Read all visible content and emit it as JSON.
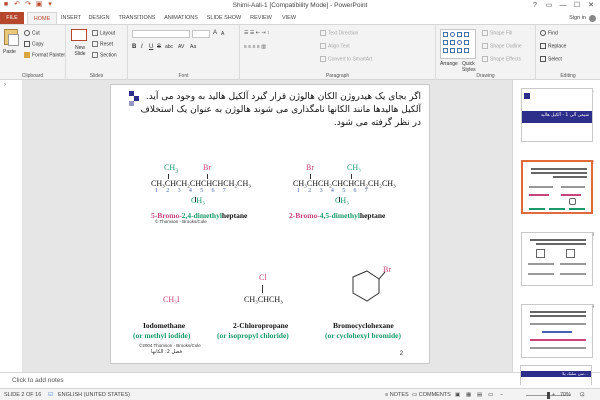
{
  "window": {
    "title": "Shimi-Aali-1 [Compatibility Mode] - PowerPoint",
    "controls": [
      "?",
      "▭",
      "—",
      "☐",
      "✕"
    ]
  },
  "qat": [
    "save-icon",
    "undo-icon",
    "redo-icon",
    "present-icon",
    "customize-icon"
  ],
  "tabs": [
    "FILE",
    "HOME",
    "INSERT",
    "DESIGN",
    "TRANSITIONS",
    "ANIMATIONS",
    "SLIDE SHOW",
    "REVIEW",
    "VIEW"
  ],
  "signin": "Sign in",
  "ribbon": {
    "clipboard": {
      "label": "Clipboard",
      "paste": "Paste",
      "cut": "Cut",
      "copy": "Copy",
      "format_painter": "Format Painter"
    },
    "slides": {
      "label": "Slides",
      "new_slide": "New Slide",
      "layout": "Layout",
      "reset": "Reset",
      "section": "Section"
    },
    "font": {
      "label": "Font",
      "bold": "B",
      "italic": "I",
      "underline": "U",
      "strike": "S",
      "shadow": "abc",
      "spacing": "AV",
      "case": "Aa",
      "grow": "A",
      "shrink": "A"
    },
    "paragraph": {
      "label": "Paragraph",
      "text_direction": "Text Direction",
      "align_text": "Align Text",
      "convert_smartart": "Convert to SmartArt"
    },
    "drawing": {
      "label": "Drawing",
      "arrange": "Arrange",
      "quick_styles": "Quick Styles",
      "shape_fill": "Shape Fill",
      "shape_outline": "Shape Outline",
      "shape_effects": "Shape Effects"
    },
    "editing": {
      "label": "Editing",
      "find": "Find",
      "replace": "Replace",
      "select": "Select"
    }
  },
  "slide": {
    "paragraph": "اگر بجای یک هیدروژن الکان هالوژن قرار گیرد آلکیل هالید به وجود می آید. آلکیل هالیدها مانند الکانها نامگذاری می شوند  هالوژن به عنوان یک استخلاف در نظر گرفته می شود.",
    "mol1": {
      "top_groups": [
        "CH",
        "Br"
      ],
      "top_subscript": "3",
      "formula": "CH₃CHCH₂CHCHCHCH₂CH₃",
      "numbers": "1 2 3 4 5 6 7",
      "bottom_group": "CH₃",
      "name_part1": "5-Bromo-",
      "name_part2": "2,4-dimethyl",
      "name_part3": "heptane",
      "copyright": "© Thomson - Brooks/Cole"
    },
    "mol2": {
      "top_groups": [
        "Br",
        "CH₃"
      ],
      "formula": "CH₃CHCH₂CHCHCH₂CH₂CH₃",
      "numbers": "1 2 3 4 5 6 7",
      "bottom_group": "CH₃",
      "name_part1": "2-Bromo-",
      "name_part2": "4,5-dimethyl",
      "name_part3": "heptane"
    },
    "mol3": {
      "formula": "CH₃I",
      "name": "Iodomethane",
      "alt": "(or methyl iodide)"
    },
    "mol4": {
      "top": "Cl",
      "formula": "CH₃CHCH₃",
      "name": "2-Chloropropane",
      "alt": "(or isopropyl chloride)"
    },
    "mol5": {
      "top": "Br",
      "name": "Bromocyclohexane",
      "alt": "(or cyclohexyl bromide)"
    },
    "copyright2": "©2004 Thomson - Brooks/Cole",
    "footer_fa": "فصل 2: الکانها",
    "page_number": "2"
  },
  "thumbnails": [
    {
      "num": "1",
      "title_fa": "شیمی آلی 1 - آلکیل هالید",
      "active": false
    },
    {
      "num": "2",
      "active": true
    },
    {
      "num": "3",
      "active": false
    },
    {
      "num": "4",
      "active": false
    },
    {
      "num": "5",
      "title_fa": "…سن سلیک پلا",
      "active": false
    }
  ],
  "notes_placeholder": "Click to add notes",
  "status": {
    "slide_count": "SLIDE 2 OF 16",
    "language": "ENGLISH (UNITED STATES)",
    "notes": "NOTES",
    "comments": "COMMENTS",
    "zoom": "70%"
  },
  "colors": {
    "accent": "#b7472a",
    "slide_deco": "#2d2d8a",
    "chem_green": "#1a9a6a",
    "chem_pink": "#c8457a",
    "chem_blue": "#4a5fb0"
  }
}
